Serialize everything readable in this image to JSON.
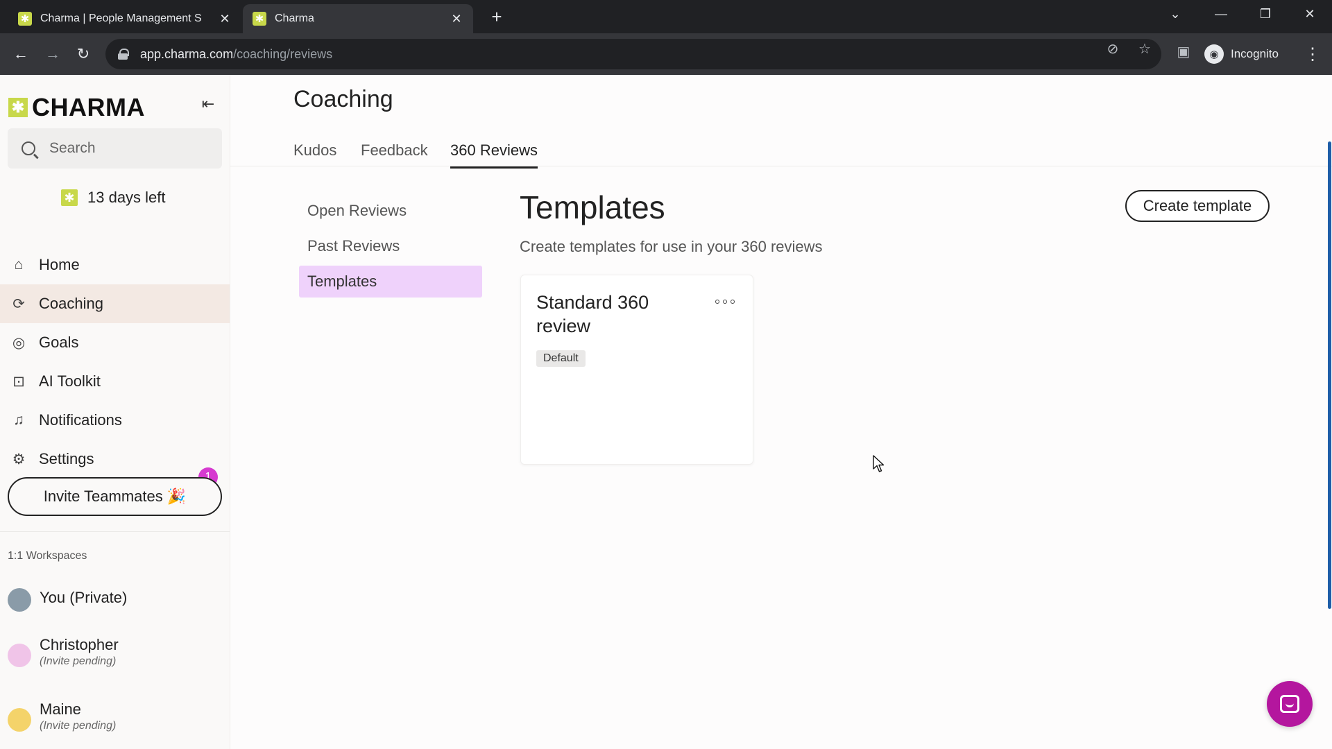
{
  "browser": {
    "tabs": [
      {
        "title": "Charma | People Management S",
        "active": false
      },
      {
        "title": "Charma",
        "active": true
      }
    ],
    "new_tab": "+",
    "url_host": "app.charma.com",
    "url_path": "/coaching/reviews",
    "profile_label": "Incognito"
  },
  "sidebar": {
    "logo": "CHARMA",
    "search_placeholder": "Search",
    "trial": "13 days left",
    "nav": [
      {
        "label": "Home",
        "icon": "home-icon",
        "active": false
      },
      {
        "label": "Coaching",
        "icon": "coaching-icon",
        "active": true
      },
      {
        "label": "Goals",
        "icon": "target-icon",
        "active": false
      },
      {
        "label": "AI Toolkit",
        "icon": "robot-icon",
        "active": false
      },
      {
        "label": "Notifications",
        "icon": "bell-icon",
        "active": false,
        "badge": "1"
      },
      {
        "label": "Settings",
        "icon": "gear-icon",
        "active": false
      }
    ],
    "invite_label": "Invite Teammates 🎉",
    "workspaces_label": "1:1 Workspaces",
    "workspaces": [
      {
        "name": "You (Private)",
        "status": ""
      },
      {
        "name": "Christopher",
        "status": "(Invite pending)"
      },
      {
        "name": "Maine",
        "status": "(Invite pending)"
      }
    ]
  },
  "main": {
    "title": "Coaching",
    "tabs": [
      {
        "label": "Kudos",
        "active": false
      },
      {
        "label": "Feedback",
        "active": false
      },
      {
        "label": "360 Reviews",
        "active": true
      }
    ],
    "subnav": [
      {
        "label": "Open Reviews",
        "active": false
      },
      {
        "label": "Past Reviews",
        "active": false
      },
      {
        "label": "Templates",
        "active": true
      }
    ],
    "section_title": "Templates",
    "section_desc": "Create templates for use in your 360 reviews",
    "create_button": "Create template",
    "templates": [
      {
        "title": "Standard 360 review",
        "badge": "Default"
      }
    ]
  },
  "colors": {
    "brand": "#c8d84a",
    "active_nav_bg": "#f3e9e3",
    "active_subnav_bg": "#efd2fb",
    "badge": "#d63ad0",
    "chat_button": "#b4169e"
  }
}
